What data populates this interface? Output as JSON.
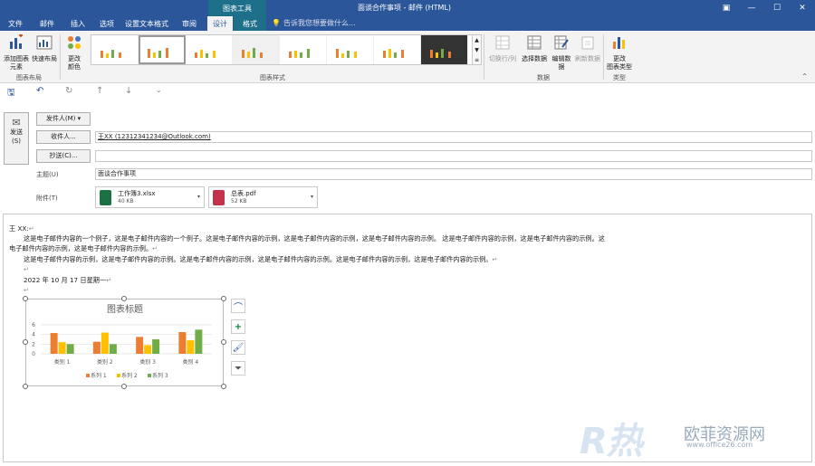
{
  "window": {
    "context_tab": "图表工具",
    "title": "面谈合作事项 - 邮件 (HTML)",
    "controls": [
      "▣",
      "—",
      "☐",
      "✕"
    ]
  },
  "tabs": [
    "文件",
    "邮件",
    "插入",
    "选项",
    "设置文本格式",
    "审阅",
    "设计",
    "格式"
  ],
  "tell_me": "告诉我您想要做什么...",
  "ribbon": {
    "add_element": "添加图表\n元素",
    "quick_layout": "快速布局",
    "change_colors": "更改\n颜色",
    "switch_row_col": "切换行/列",
    "select_data": "选择数据",
    "edit_data": "编辑数\n据",
    "refresh_data": "刷新数据",
    "change_type": "更改\n图表类型",
    "groups": {
      "layout": "图表布局",
      "styles": "图表样式",
      "data": "数据",
      "type": "类型"
    }
  },
  "compose": {
    "send": "发送\n(S)",
    "from": "发件人(M)",
    "to_btn": "收件人...",
    "cc_btn": "抄送(C)...",
    "to_value": "王XX (12312341234@Outlook.com)",
    "cc_value": "",
    "subject_label": "主题(U)",
    "subject_value": "面谈合作事项",
    "attach_label": "附件(T)",
    "attachments": [
      {
        "name": "工作簿3.xlsx",
        "size": "40 KB"
      },
      {
        "name": "总表.pdf",
        "size": "52 KB"
      }
    ]
  },
  "body": {
    "greeting": "王 XX:",
    "line1": "这是电子邮件内容的一个例子，这是电子邮件内容的一个例子。这是电子邮件内容的示例，这是电子邮件内容的示例，这是电子邮件内容的示例。 这是电子邮件内容的示例，这是电子邮件内容的示例。这",
    "line2": "电子邮件内容的示例，这是电子邮件内容的示例。",
    "line3": "这是电子邮件内容的示例，这是电子邮件内容的示例。这是电子邮件内容的示例，这是电子邮件内容的示例。这是电子邮件内容的示例，这是电子邮件内容的示例。",
    "date": "2022 年 10 月 17 日星期一"
  },
  "chart_data": {
    "type": "bar",
    "title": "图表标题",
    "categories": [
      "类别 1",
      "类别 2",
      "类别 3",
      "类别 4"
    ],
    "series": [
      {
        "name": "系列 1",
        "values": [
          4.3,
          2.5,
          3.5,
          4.5
        ],
        "color": "#ed7d31"
      },
      {
        "name": "系列 2",
        "values": [
          2.4,
          4.4,
          1.8,
          2.8
        ],
        "color": "#ffc000"
      },
      {
        "name": "系列 3",
        "values": [
          2,
          2,
          3,
          5
        ],
        "color": "#70ad47"
      }
    ],
    "ylim": [
      0,
      6
    ],
    "yticks": [
      "0",
      "2",
      "4",
      "6"
    ],
    "legend": "bottom",
    "grid": true
  },
  "watermark": {
    "brand": "欧菲资源网",
    "url": "www.office26.com"
  }
}
